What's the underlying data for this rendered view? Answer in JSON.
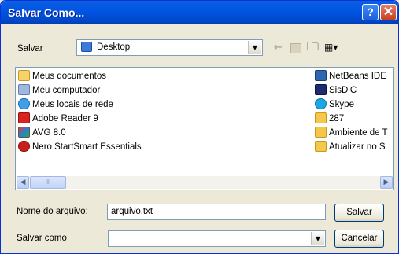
{
  "window": {
    "title": "Salvar Como...",
    "help_label": "?",
    "close_label": "✕"
  },
  "location": {
    "label": "Salvar",
    "current": "Desktop"
  },
  "files": {
    "left_column": [
      {
        "name": "Meus documentos",
        "icon": "my-documents-icon"
      },
      {
        "name": "Meu computador",
        "icon": "my-computer-icon"
      },
      {
        "name": "Meus locais de rede",
        "icon": "network-places-icon"
      },
      {
        "name": "Adobe Reader 9",
        "icon": "adobe-reader-icon"
      },
      {
        "name": "AVG 8.0",
        "icon": "avg-icon"
      },
      {
        "name": "Nero StartSmart Essentials",
        "icon": "nero-icon"
      }
    ],
    "right_column": [
      {
        "name": "NetBeans IDE",
        "icon": "netbeans-icon"
      },
      {
        "name": "SisDiC",
        "icon": "sisdic-icon"
      },
      {
        "name": "Skype",
        "icon": "skype-icon"
      },
      {
        "name": "287",
        "icon": "folder-icon"
      },
      {
        "name": "Ambiente de T",
        "icon": "folder-icon"
      },
      {
        "name": "Atualizar no S",
        "icon": "folder-icon"
      }
    ]
  },
  "form": {
    "filename_label": "Nome do arquivo:",
    "filename_value": "arquivo.txt",
    "filetype_label": "Salvar como",
    "filetype_value": ""
  },
  "buttons": {
    "save": "Salvar",
    "cancel": "Cancelar"
  },
  "colors": {
    "title_bar": "#0054e3",
    "dialog_bg": "#ece9d8",
    "folder": "#f5c84c"
  }
}
